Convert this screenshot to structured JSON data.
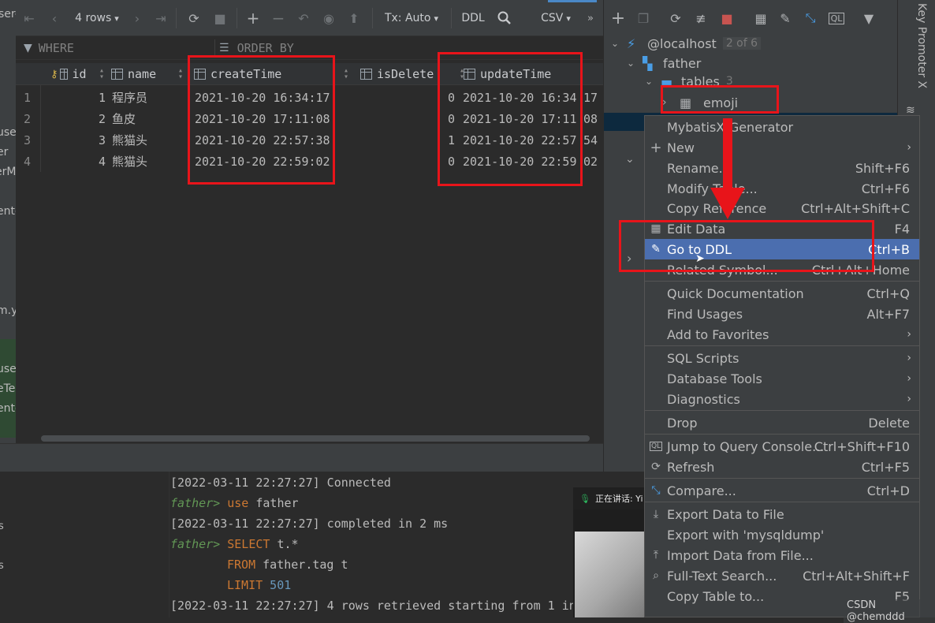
{
  "toolbar": {
    "rows_label": "4 rows",
    "tx_label": "Tx: Auto",
    "ddl_label": "DDL",
    "csv_label": "CSV",
    "more_label": "»"
  },
  "filter": {
    "where_label": "WHERE",
    "orderby_label": "ORDER BY"
  },
  "grid": {
    "columns": [
      "id",
      "name",
      "createTime",
      "isDelete",
      "updateTime"
    ],
    "rows": [
      {
        "num": "1",
        "id": "1",
        "name": "程序员",
        "createTime": "2021-10-20 16:34:17",
        "isDelete": "0",
        "updateTime": "2021-10-20 16:34",
        "tail": "17"
      },
      {
        "num": "2",
        "id": "2",
        "name": "鱼皮",
        "createTime": "2021-10-20 17:11:08",
        "isDelete": "0",
        "updateTime": "2021-10-20 17:11",
        "tail": "08"
      },
      {
        "num": "3",
        "id": "3",
        "name": "熊猫头",
        "createTime": "2021-10-20 22:57:38",
        "isDelete": "1",
        "updateTime": "2021-10-20 22:57",
        "tail": "54"
      },
      {
        "num": "4",
        "id": "4",
        "name": "熊猫头",
        "createTime": "2021-10-20 22:59:02",
        "isDelete": "0",
        "updateTime": "2021-10-20 22:59",
        "tail": "02"
      }
    ]
  },
  "left_edge": [
    "ser-",
    "use",
    "er",
    "erM",
    "ente",
    "m.y",
    "use",
    "eTe",
    "ente",
    "s",
    "s"
  ],
  "tree": {
    "host": "@localhost",
    "host_badge": "2 of 6",
    "schema": "father",
    "folder": "tables",
    "folder_count": "3",
    "table": "emoji"
  },
  "right_strip": "Key Promoter X",
  "context_menu": [
    {
      "label": "MybatisX-Generator",
      "shortcut": "",
      "icon": "",
      "submenu": false
    },
    {
      "label": "New",
      "shortcut": "",
      "icon": "plus-icon",
      "submenu": true
    },
    {
      "label": "Rename...",
      "shortcut": "Shift+F6",
      "icon": "",
      "submenu": false
    },
    {
      "label": "Modify Table...",
      "shortcut": "Ctrl+F6",
      "icon": "",
      "submenu": false
    },
    {
      "label": "Copy Reference",
      "shortcut": "Ctrl+Alt+Shift+C",
      "icon": "",
      "submenu": false
    },
    {
      "label": "Edit Data",
      "shortcut": "F4",
      "icon": "table-icon",
      "submenu": false
    },
    {
      "label": "Go to DDL",
      "shortcut": "Ctrl+B",
      "icon": "pencil-icon",
      "submenu": false
    },
    {
      "label": "Related Symbol...",
      "shortcut": "Ctrl+Alt+Home",
      "icon": "",
      "submenu": false
    },
    {
      "label": "Quick Documentation",
      "shortcut": "Ctrl+Q",
      "icon": "",
      "submenu": false
    },
    {
      "label": "Find Usages",
      "shortcut": "Alt+F7",
      "icon": "",
      "submenu": false
    },
    {
      "label": "Add to Favorites",
      "shortcut": "",
      "icon": "",
      "submenu": true
    },
    {
      "label": "SQL Scripts",
      "shortcut": "",
      "icon": "",
      "submenu": true
    },
    {
      "label": "Database Tools",
      "shortcut": "",
      "icon": "",
      "submenu": true
    },
    {
      "label": "Diagnostics",
      "shortcut": "",
      "icon": "",
      "submenu": true
    },
    {
      "label": "Drop",
      "shortcut": "Delete",
      "icon": "",
      "submenu": false
    },
    {
      "label": "Jump to Query Console...",
      "shortcut": "Ctrl+Shift+F10",
      "icon": "console-icon",
      "submenu": false
    },
    {
      "label": "Refresh",
      "shortcut": "Ctrl+F5",
      "icon": "refresh-icon",
      "submenu": false
    },
    {
      "label": "Compare...",
      "shortcut": "Ctrl+D",
      "icon": "compare-icon",
      "submenu": false
    },
    {
      "label": "Export Data to File",
      "shortcut": "",
      "icon": "export-icon",
      "submenu": false
    },
    {
      "label": "Export with 'mysqldump'",
      "shortcut": "",
      "icon": "",
      "submenu": false
    },
    {
      "label": "Import Data from File...",
      "shortcut": "",
      "icon": "import-icon",
      "submenu": false
    },
    {
      "label": "Full-Text Search...",
      "shortcut": "Ctrl+Alt+Shift+F",
      "icon": "search-icon",
      "submenu": false
    },
    {
      "label": "Copy Table to...",
      "shortcut": "F5",
      "icon": "",
      "submenu": false
    }
  ],
  "console": {
    "line1": "[2022-03-11 22:27:27] Connected",
    "prompt": "father>",
    "line2_kw": "use",
    "line2_rest": " father",
    "line3": "[2022-03-11 22:27:27] completed in 2 ms",
    "line4_kw": "SELECT",
    "line4_rest": " t.*",
    "line5_kw": "FROM",
    "line5_rest": " father.tag t",
    "line6_kw": "LIMIT",
    "line6_rest": " 501",
    "line7": "[2022-03-11 22:27:27] 4 rows retrieved starting from 1 in"
  },
  "video": {
    "speaking_label": "正在讲话: Yi"
  },
  "watermark": "CSDN @chemddd",
  "colors": {
    "highlight_red": "#e8141a",
    "selection_blue": "#4b6eaf",
    "keyword_orange": "#cc7832",
    "prompt_green": "#629755"
  }
}
